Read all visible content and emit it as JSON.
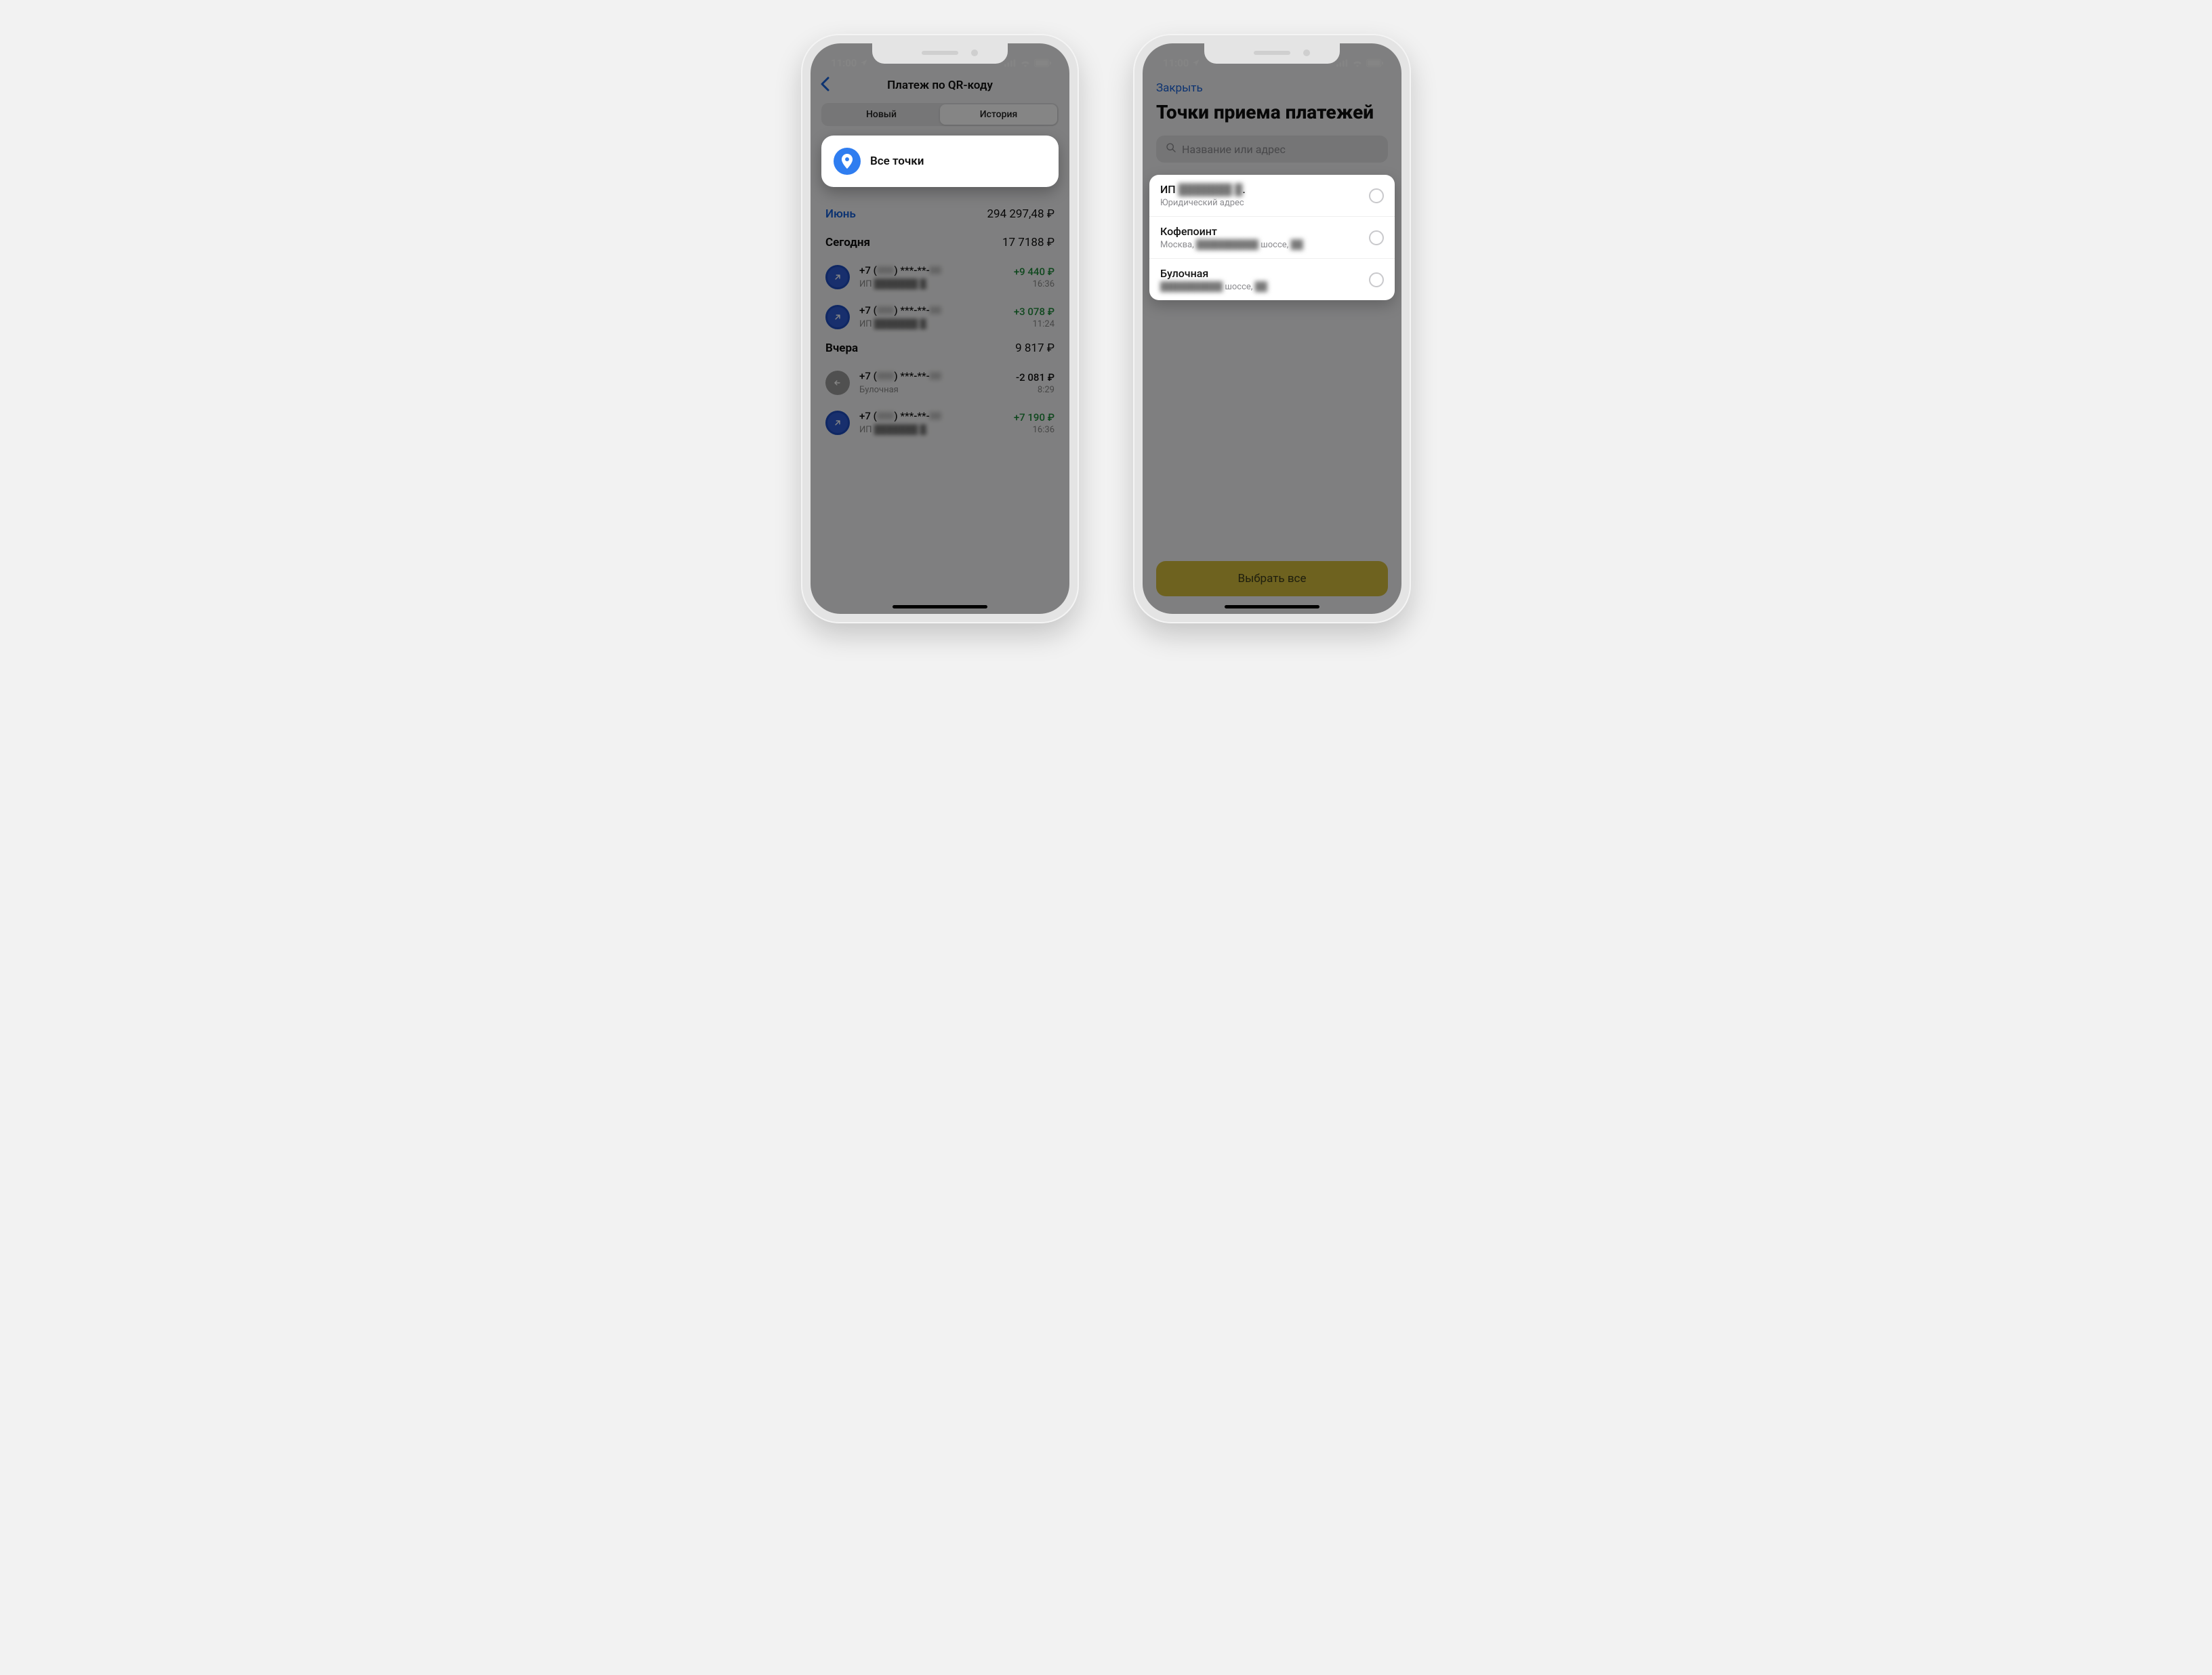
{
  "status": {
    "time": "11:00"
  },
  "left": {
    "title": "Платеж по QR-коду",
    "tabs": {
      "new": "Новый",
      "history": "История"
    },
    "allpoints": "Все точки",
    "month": {
      "label": "Июнь",
      "total": "294 297,48 ₽"
    },
    "groups": [
      {
        "title": "Сегодня",
        "total": "17 7188 ₽",
        "txns": [
          {
            "dir": "in",
            "mask_prefix": "+7 (",
            "mask_area": "000",
            "mask_mid": ") ***-**-",
            "mask_last": "00",
            "sub_prefix": "ИП ",
            "sub_blur": "███████ █.",
            "amount": "+9 440 ₽",
            "time": "16:36"
          },
          {
            "dir": "in",
            "mask_prefix": "+7 (",
            "mask_area": "000",
            "mask_mid": ") ***-**-",
            "mask_last": "00",
            "sub_prefix": "ИП ",
            "sub_blur": "███████ █.",
            "amount": "+3 078 ₽",
            "time": "11:24"
          }
        ]
      },
      {
        "title": "Вчера",
        "total": "9 817 ₽",
        "txns": [
          {
            "dir": "out",
            "mask_prefix": "+7 (",
            "mask_area": "000",
            "mask_mid": ") ***-**-",
            "mask_last": "00",
            "sub_prefix": "",
            "sub_blur": "",
            "sub_plain": "Булочная",
            "amount": "-2 081 ₽",
            "time": "8:29"
          },
          {
            "dir": "in",
            "mask_prefix": "+7 (",
            "mask_area": "000",
            "mask_mid": ") ***-**-",
            "mask_last": "00",
            "sub_prefix": "ИП ",
            "sub_blur": "███████ █.",
            "amount": "+7 190 ₽",
            "time": "16:36"
          }
        ]
      }
    ]
  },
  "right": {
    "close": "Закрыть",
    "title": "Точки приема платежей",
    "search_placeholder": "Название или адрес",
    "items": [
      {
        "name_prefix": "ИП ",
        "name_blur": "███████ █",
        "name_suffix": ".",
        "addr": "Юридический адрес"
      },
      {
        "name": "Кофепоинт",
        "addr_prefix": "Москва, ",
        "addr_blur": "██████████",
        "addr_mid": " шоссе, ",
        "addr_blur2": "██"
      },
      {
        "name": "Булочная",
        "addr_blur": "██████████",
        "addr_mid": " шоссе, ",
        "addr_blur2": "██"
      }
    ],
    "select_all": "Выбрать все"
  }
}
